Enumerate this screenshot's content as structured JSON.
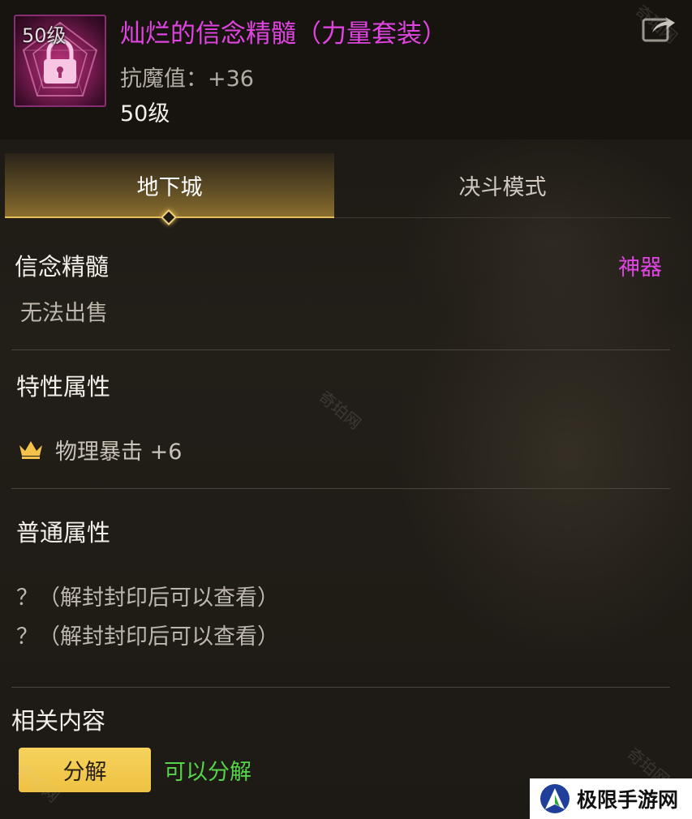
{
  "header": {
    "level_badge": "50级",
    "title": "灿烂的信念精髓（力量套装）",
    "stat": "抗魔值：+36",
    "level_requirement": "50级",
    "title_color": "#e044e0"
  },
  "tabs": [
    {
      "label": "地下城",
      "active": true
    },
    {
      "label": "决斗模式",
      "active": false
    }
  ],
  "item_info": {
    "type": "信念精髓",
    "rarity": "神器",
    "rarity_color": "#e245e6",
    "sell_status": "无法出售"
  },
  "special_attributes": {
    "title": "特性属性",
    "items": [
      {
        "icon": "crown-icon",
        "text": "物理暴击 +6"
      }
    ]
  },
  "normal_attributes": {
    "title": "普通属性",
    "items": [
      "？（解封封印后可以查看）",
      "？（解封封印后可以查看）"
    ]
  },
  "related": {
    "title": "相关内容",
    "button_label": "分解",
    "status": "可以分解",
    "status_color": "#55d44a"
  },
  "watermarks": [
    "奇珀网",
    "奇珀网",
    "奇珀网",
    "奇珀网"
  ],
  "brand": {
    "text": "极限手游网"
  },
  "icons": [
    "lock-icon",
    "share-icon",
    "crown-icon",
    "brand-logo-icon"
  ]
}
